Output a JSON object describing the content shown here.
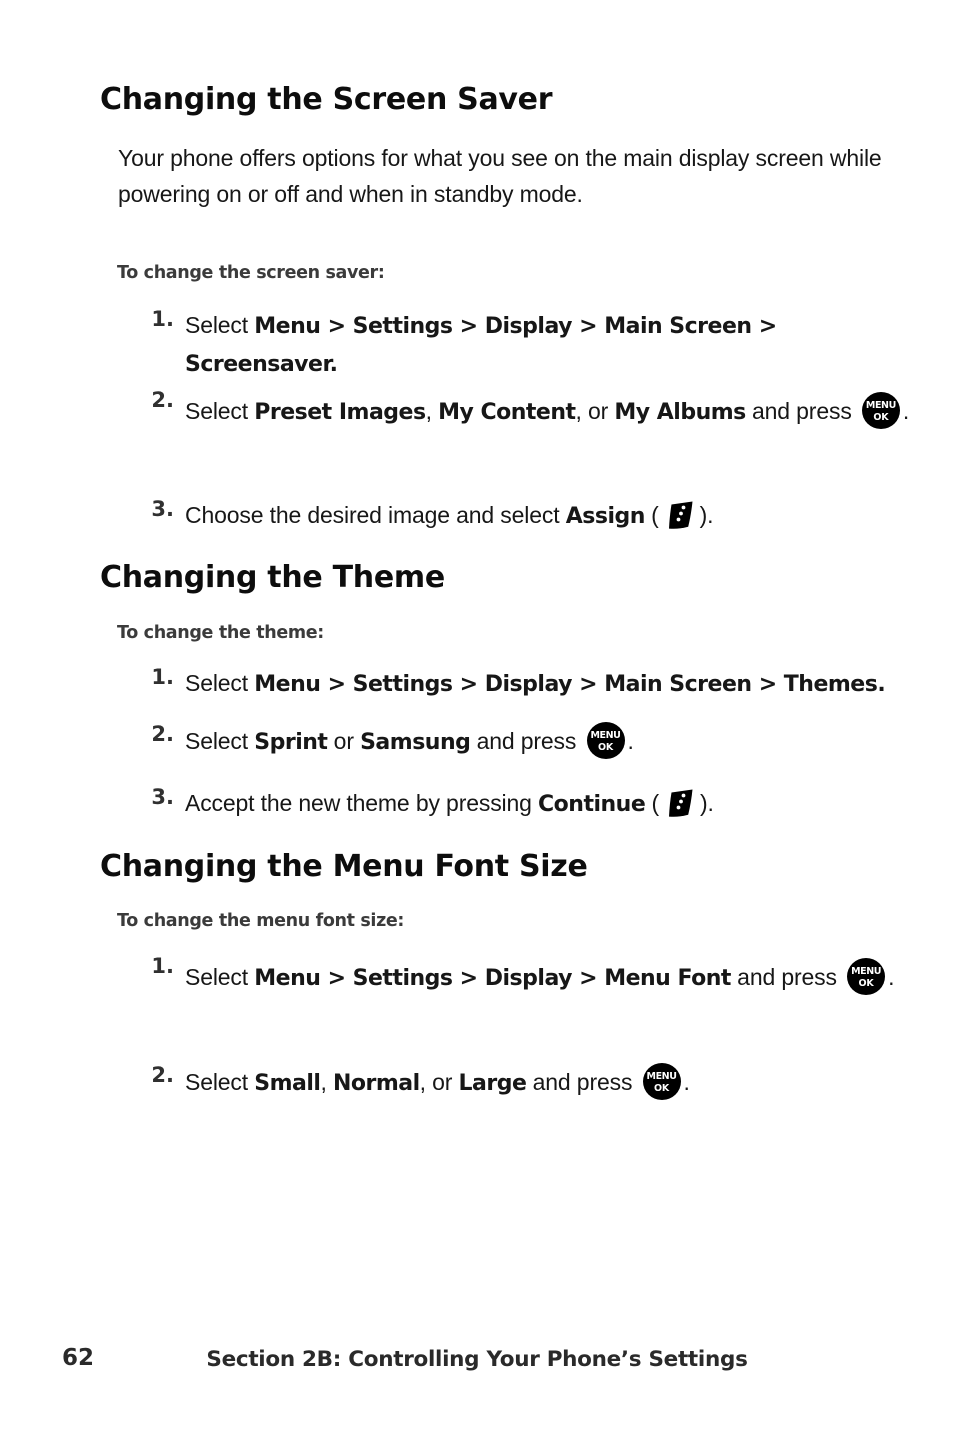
{
  "page": {
    "background": "#ffffff",
    "text_color": "#171717",
    "heading_color": "#0d0d0d",
    "subheading_color": "#3b3b3b"
  },
  "sections": [
    {
      "heading": "Changing the Screen Saver",
      "paragraph": "Your phone offers options for what you see on the main display screen while powering on or off and when in standby mode.",
      "subheading": "To change the screen saver:",
      "steps": [
        {
          "number": "1.",
          "html": "Select <b>Menu &gt; Settings &gt; Display &gt; Main Screen &gt; Screensaver.</b>"
        },
        {
          "number": "2.",
          "html": "Select <b>Preset Images</b>, <b>My Content</b>, or <b>My Albums</b> and press <icon:menuok>."
        },
        {
          "number": "3.",
          "html": "Choose the desired image and select <b>Assign</b> (<icon:softkey>)."
        }
      ]
    },
    {
      "heading": "Changing the Theme",
      "paragraph": "",
      "subheading": "To change the theme:",
      "steps": [
        {
          "number": "1.",
          "html": "Select <b>Menu &gt; Settings &gt; Display &gt; Main Screen &gt; Themes.</b>"
        },
        {
          "number": "2.",
          "html": "Select <b>Sprint</b> or <b>Samsung</b> and press <icon:menuok>."
        },
        {
          "number": "3.",
          "html": "Accept the new theme by pressing <b>Continue</b> (<icon:softkey>)."
        }
      ]
    },
    {
      "heading": "Changing the Menu Font Size",
      "paragraph": "",
      "subheading": "To change the menu font size:",
      "steps": [
        {
          "number": "1.",
          "html": "Select <b>Menu &gt; Settings &gt; Display &gt; Menu Font</b> and press <icon:menuok>."
        },
        {
          "number": "2.",
          "html": "Select <b>Small</b>, <b>Normal</b>, or <b>Large</b> and press <icon:menuok>."
        }
      ]
    }
  ],
  "icons": {
    "menuok": {
      "name": "menu-ok-key-icon",
      "line1": "MENU",
      "line2": "OK",
      "color": "#000000"
    },
    "softkey": {
      "name": "softkey-options-icon",
      "dots": 3,
      "color": "#000000"
    }
  },
  "footer": {
    "page_number": "62",
    "title": "Section 2B: Controlling Your Phone’s Settings"
  }
}
